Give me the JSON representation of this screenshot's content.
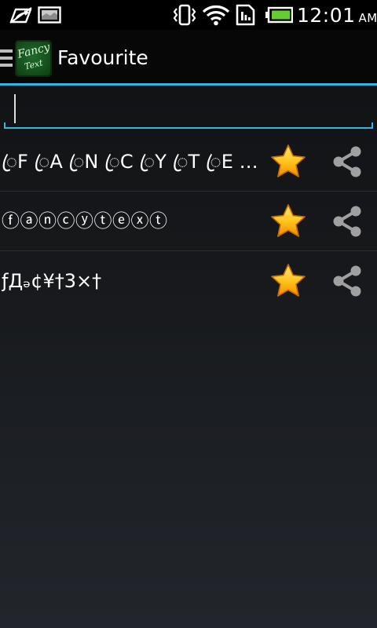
{
  "status_bar": {
    "time": "12:01",
    "ampm": "AM"
  },
  "action_bar": {
    "icon_text_line1": "Fancy",
    "icon_text_line2": "Text",
    "title": "Favourite"
  },
  "search": {
    "value": "",
    "placeholder": ""
  },
  "favourites": [
    {
      "text": "ꦿF ꦿA ꦿN ꦿC ꦿY ꦿT ꦿE ꦿX ꦿT"
    },
    {
      "text": "ⓕⓐⓝⓒⓨⓣⓔⓧⓣ"
    },
    {
      "text": "ƒДₔ¢¥†3×†"
    }
  ],
  "icons": {
    "drawer": "hamburger-icon",
    "favourite": "star-icon",
    "share": "share-icon"
  },
  "colors": {
    "accent": "#33b5e5",
    "star": "#ffc21a",
    "share": "#a0a0a0"
  }
}
